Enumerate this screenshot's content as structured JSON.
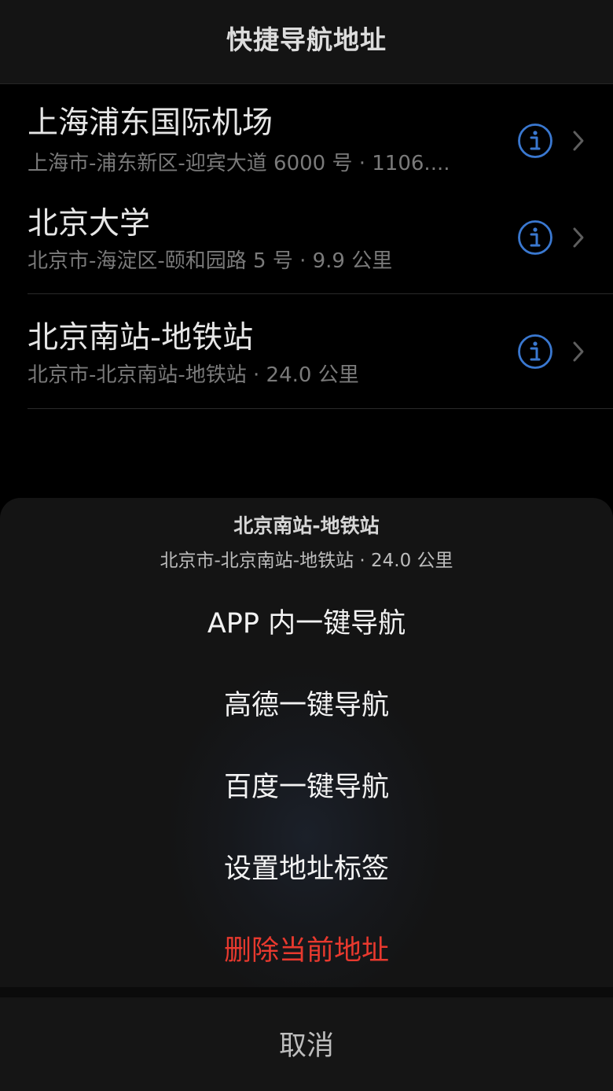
{
  "nav": {
    "title": "快捷导航地址"
  },
  "addresses": [
    {
      "name": "上海浦东国际机场",
      "detail": "上海市-浦东新区-迎宾大道 6000 号 · 1106...."
    },
    {
      "name": "北京大学",
      "detail": "北京市-海淀区-颐和园路 5 号 · 9.9 公里"
    },
    {
      "name": "北京南站-地铁站",
      "detail": "北京市-北京南站-地铁站 · 24.0 公里"
    }
  ],
  "sheet": {
    "title": "北京南站-地铁站",
    "subtitle": "北京市-北京南站-地铁站 · 24.0 公里",
    "actions": [
      {
        "label": "APP 内一键导航"
      },
      {
        "label": "高德一键导航"
      },
      {
        "label": "百度一键导航"
      },
      {
        "label": "设置地址标签"
      },
      {
        "label": "删除当前地址"
      }
    ],
    "cancel_label": "取消"
  },
  "colors": {
    "accent": "#3a78d0",
    "danger": "#e8392e",
    "background": "#000000"
  },
  "icons": {
    "info": "info-icon",
    "chevron": "chevron-right-icon"
  }
}
